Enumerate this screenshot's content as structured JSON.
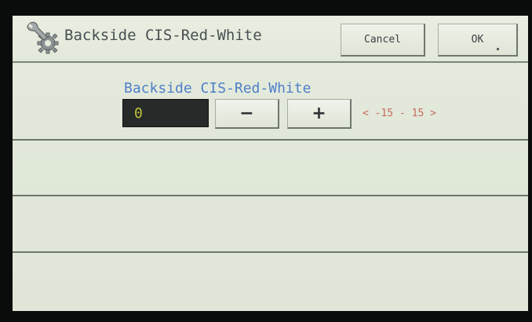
{
  "header": {
    "title": "Backside CIS-Red-White",
    "cancel_label": "Cancel",
    "ok_label": "OK",
    "icon": "wrench-gear-icon"
  },
  "adjust": {
    "label": "Backside CIS-Red-White",
    "value": "0",
    "minus_label": "−",
    "plus_label": "+",
    "range": "< -15 - 15 >"
  },
  "colors": {
    "screen_bg": "#e3e9da",
    "label_blue": "#4f7fc8",
    "value_yellow": "#c4c03a",
    "range_red": "#c96a5e",
    "value_bg": "#262b2a"
  }
}
